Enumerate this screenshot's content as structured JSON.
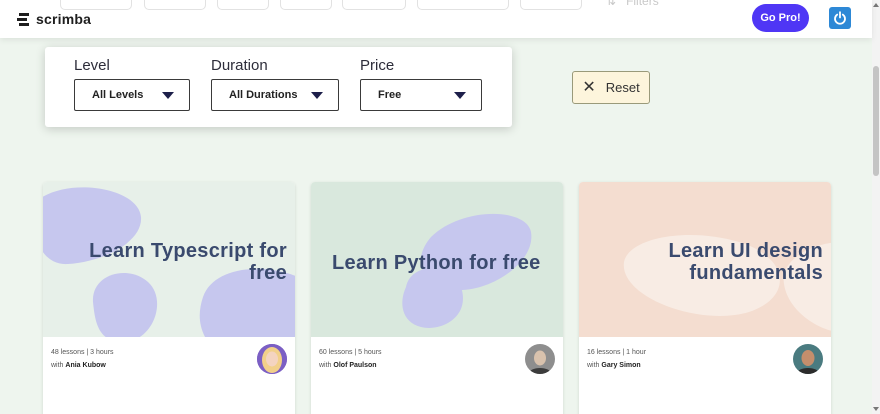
{
  "header": {
    "brand": "scrimba",
    "filters_label": "Filters",
    "go_pro_label": "Go Pro!",
    "power_icon": "power-icon"
  },
  "filters": {
    "level": {
      "label": "Level",
      "value": "All Levels"
    },
    "duration": {
      "label": "Duration",
      "value": "All Durations"
    },
    "price": {
      "label": "Price",
      "value": "Free"
    },
    "reset_label": "Reset"
  },
  "courses": [
    {
      "title_line1": "Learn Typescript for",
      "title_line2": "free",
      "lessons": "48 lessons | 3 hours",
      "with": "with",
      "author": "Ania Kubow",
      "bg": "#e7f0e9",
      "blob": "#c6c7ee"
    },
    {
      "title_line1": "Learn Python for free",
      "title_line2": "",
      "lessons": "60 lessons | 5 hours",
      "with": "with",
      "author": "Olof Paulson",
      "bg": "#d9e8dd",
      "blob": "#c6c7ee"
    },
    {
      "title_line1": "Learn UI design",
      "title_line2": "fundamentals",
      "lessons": "16 lessons | 1 hour",
      "with": "with",
      "author": "Gary Simon",
      "bg": "#f4ddd0",
      "blob": "#f8ece4"
    }
  ],
  "colors": {
    "accent": "#4f36f5",
    "page_bg": "#eef5ee",
    "title": "#3a4a6e"
  }
}
